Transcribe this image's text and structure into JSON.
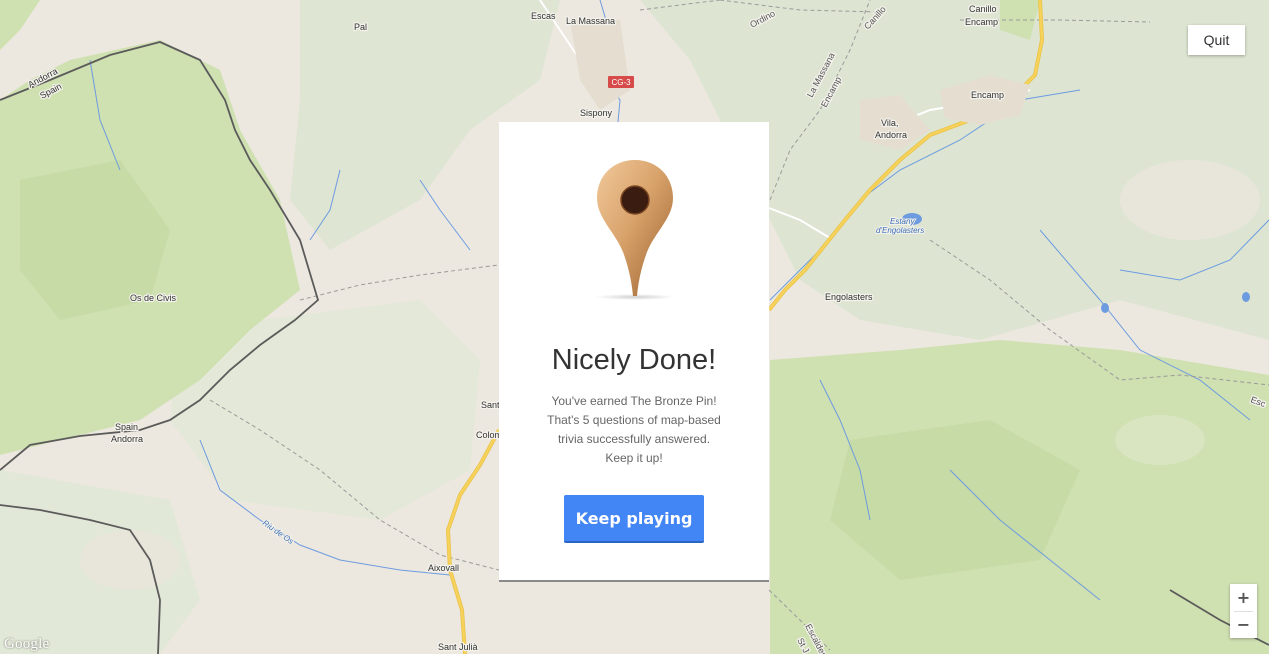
{
  "map": {
    "labels": {
      "pal": "Pal",
      "escas": "Escas",
      "la_massana": "La Massana",
      "ordino": "Ordino",
      "canillo_angled": "Canillo",
      "canillo": "Canillo",
      "encamp_top": "Encamp",
      "la_massana_road": "La Massana",
      "encamp_road": "Encamp",
      "andorra_tl": "Andorra",
      "spain_tl": "Spain",
      "cg3": "CG-3",
      "sispony": "Sispony",
      "encamp_town": "Encamp",
      "vila": "Vila,",
      "andorra_vila": "Andorra",
      "estany_1": "Estany",
      "estany_2": "d'Engolasters",
      "engolasters": "Engolasters",
      "os_de_civis": "Os de Civis",
      "spain_bl": "Spain",
      "andorra_bl": "Andorra",
      "sant": "Sant",
      "colom": "Colom",
      "riu": "Riu de Os",
      "aixovall": "Aixovall",
      "sant_julia": "Sant Julià",
      "escaldes": "Escaldes",
      "st_j": "St J",
      "esc_edge": "Esc"
    },
    "colors": {
      "land": "#ece8df",
      "forest": "#cfe0b1",
      "forest_dark": "#c4d9a2",
      "hills": "#dde4d0",
      "water": "#5a8fe0",
      "road_main": "#f7d25a",
      "border": "#5b5b5b"
    }
  },
  "controls": {
    "quit_label": "Quit",
    "zoom_in_label": "+",
    "zoom_out_label": "−"
  },
  "branding": {
    "logo_text": "Google"
  },
  "dialog": {
    "pin_icon": "bronze-pin-icon",
    "pin_color": "#c8905a",
    "title": "Nicely Done!",
    "body_lines": [
      "You've earned The Bronze Pin!",
      "That's 5 questions of map-based",
      "trivia successfully answered.",
      "Keep it up!"
    ],
    "button_label": "Keep playing",
    "button_color": "#4285f4"
  }
}
